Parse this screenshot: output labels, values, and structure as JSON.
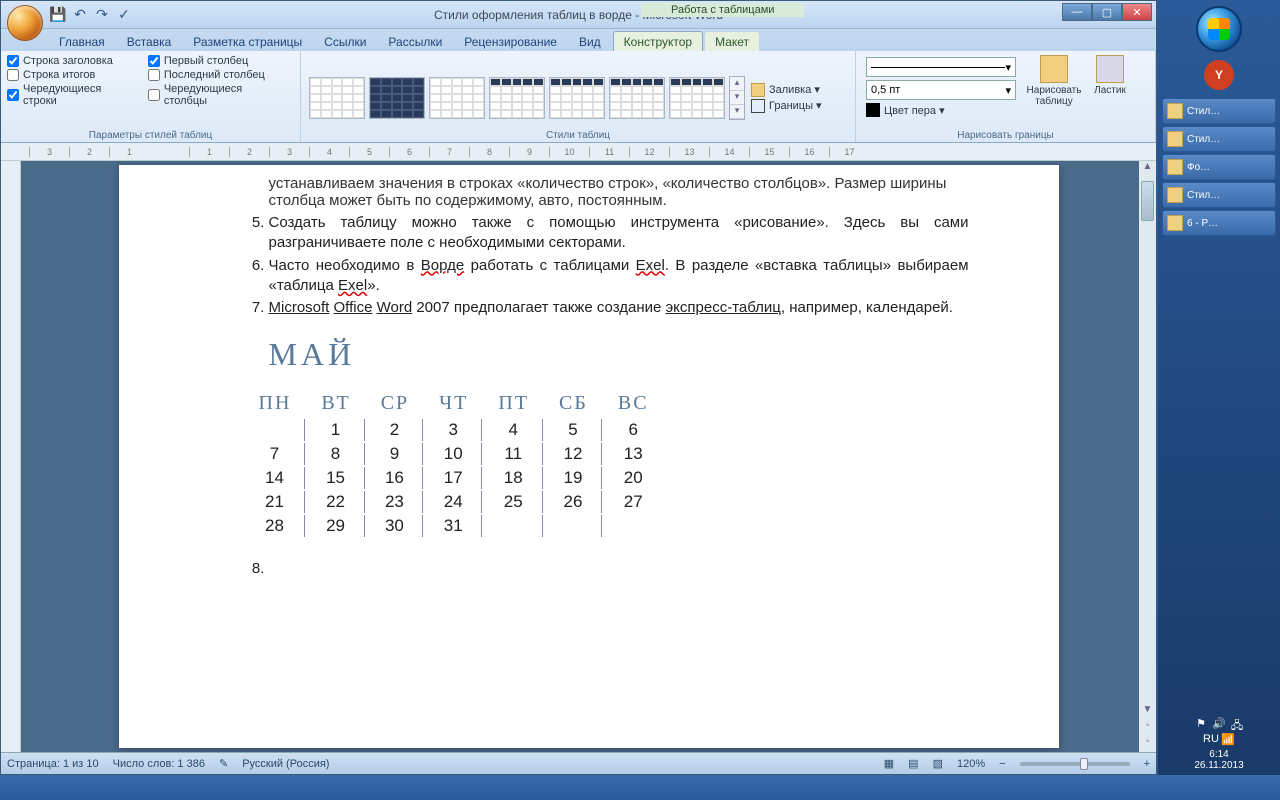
{
  "title": "Стили оформления таблиц в ворде - Microsoft Word",
  "tableTools": "Работа с таблицами",
  "qat": {
    "save": "💾",
    "undo": "↶",
    "redo": "↷",
    "spell": "✓"
  },
  "tabs": [
    "Главная",
    "Вставка",
    "Разметка страницы",
    "Ссылки",
    "Рассылки",
    "Рецензирование",
    "Вид",
    "Конструктор",
    "Макет"
  ],
  "activeTab": "Конструктор",
  "ribbon": {
    "styleOptions": {
      "label": "Параметры стилей таблиц",
      "left": [
        {
          "label": "Строка заголовка",
          "checked": true
        },
        {
          "label": "Строка итогов",
          "checked": false
        },
        {
          "label": "Чередующиеся строки",
          "checked": true
        }
      ],
      "right": [
        {
          "label": "Первый столбец",
          "checked": true
        },
        {
          "label": "Последний столбец",
          "checked": false
        },
        {
          "label": "Чередующиеся столбцы",
          "checked": false
        }
      ]
    },
    "tableStyles": {
      "label": "Стили таблиц",
      "shading": "Заливка ▾",
      "borders": "Границы ▾"
    },
    "drawBorders": {
      "label": "Нарисовать границы",
      "penWeight": "0,5 пт",
      "penColor": "Цвет пера ▾",
      "draw": "Нарисовать таблицу",
      "erase": "Ластик"
    }
  },
  "ruler": [
    "3",
    "2",
    "1",
    "",
    "1",
    "2",
    "3",
    "4",
    "5",
    "6",
    "7",
    "8",
    "9",
    "10",
    "11",
    "12",
    "13",
    "14",
    "15",
    "16",
    "17"
  ],
  "doc": {
    "clipped": "устанавливаем значения в строках «количество строк», «количество столбцов». Размер ширины столбца может быть по содержимому, авто, постоянным.",
    "items": [
      {
        "n": 5,
        "text": "Создать таблицу можно также с помощью инструмента «рисование». Здесь вы сами разграничиваете поле с необходимыми секторами."
      },
      {
        "n": 6,
        "pre": "Часто необходимо в ",
        "w1": "Ворде",
        "mid": " работать с таблицами ",
        "w2": "Exel",
        "post": ". В разделе «вставка таблицы» выбираем «таблица ",
        "w3": "Exel",
        "end": "»."
      },
      {
        "n": 7,
        "u1": "Microsoft",
        "sp1": "   ",
        "u2": "Office",
        "sp2": "   ",
        "u3": "Word",
        "mid": "   2007 предполагает также создание ",
        "u4": "экспресс-таблиц",
        "end": ", например, календарей."
      },
      {
        "n": 8,
        "text": ""
      }
    ],
    "month": "МАЙ",
    "days": [
      "ПН",
      "ВТ",
      "СР",
      "ЧТ",
      "ПТ",
      "СБ",
      "ВС"
    ],
    "weeks": [
      [
        "",
        "1",
        "2",
        "3",
        "4",
        "5",
        "6"
      ],
      [
        "7",
        "8",
        "9",
        "10",
        "11",
        "12",
        "13"
      ],
      [
        "14",
        "15",
        "16",
        "17",
        "18",
        "19",
        "20"
      ],
      [
        "21",
        "22",
        "23",
        "24",
        "25",
        "26",
        "27"
      ],
      [
        "28",
        "29",
        "30",
        "31",
        "",
        "",
        ""
      ]
    ]
  },
  "status": {
    "page": "Страница: 1 из 10",
    "words": "Число слов: 1 386",
    "lang": "Русский (Россия)",
    "zoom": "120%"
  },
  "sidebar": {
    "tasks": [
      "Стил…",
      "Стил…",
      "Фо…",
      "Стил…",
      "6 - Р…"
    ],
    "time": "6:14",
    "date": "26.11.2013"
  }
}
